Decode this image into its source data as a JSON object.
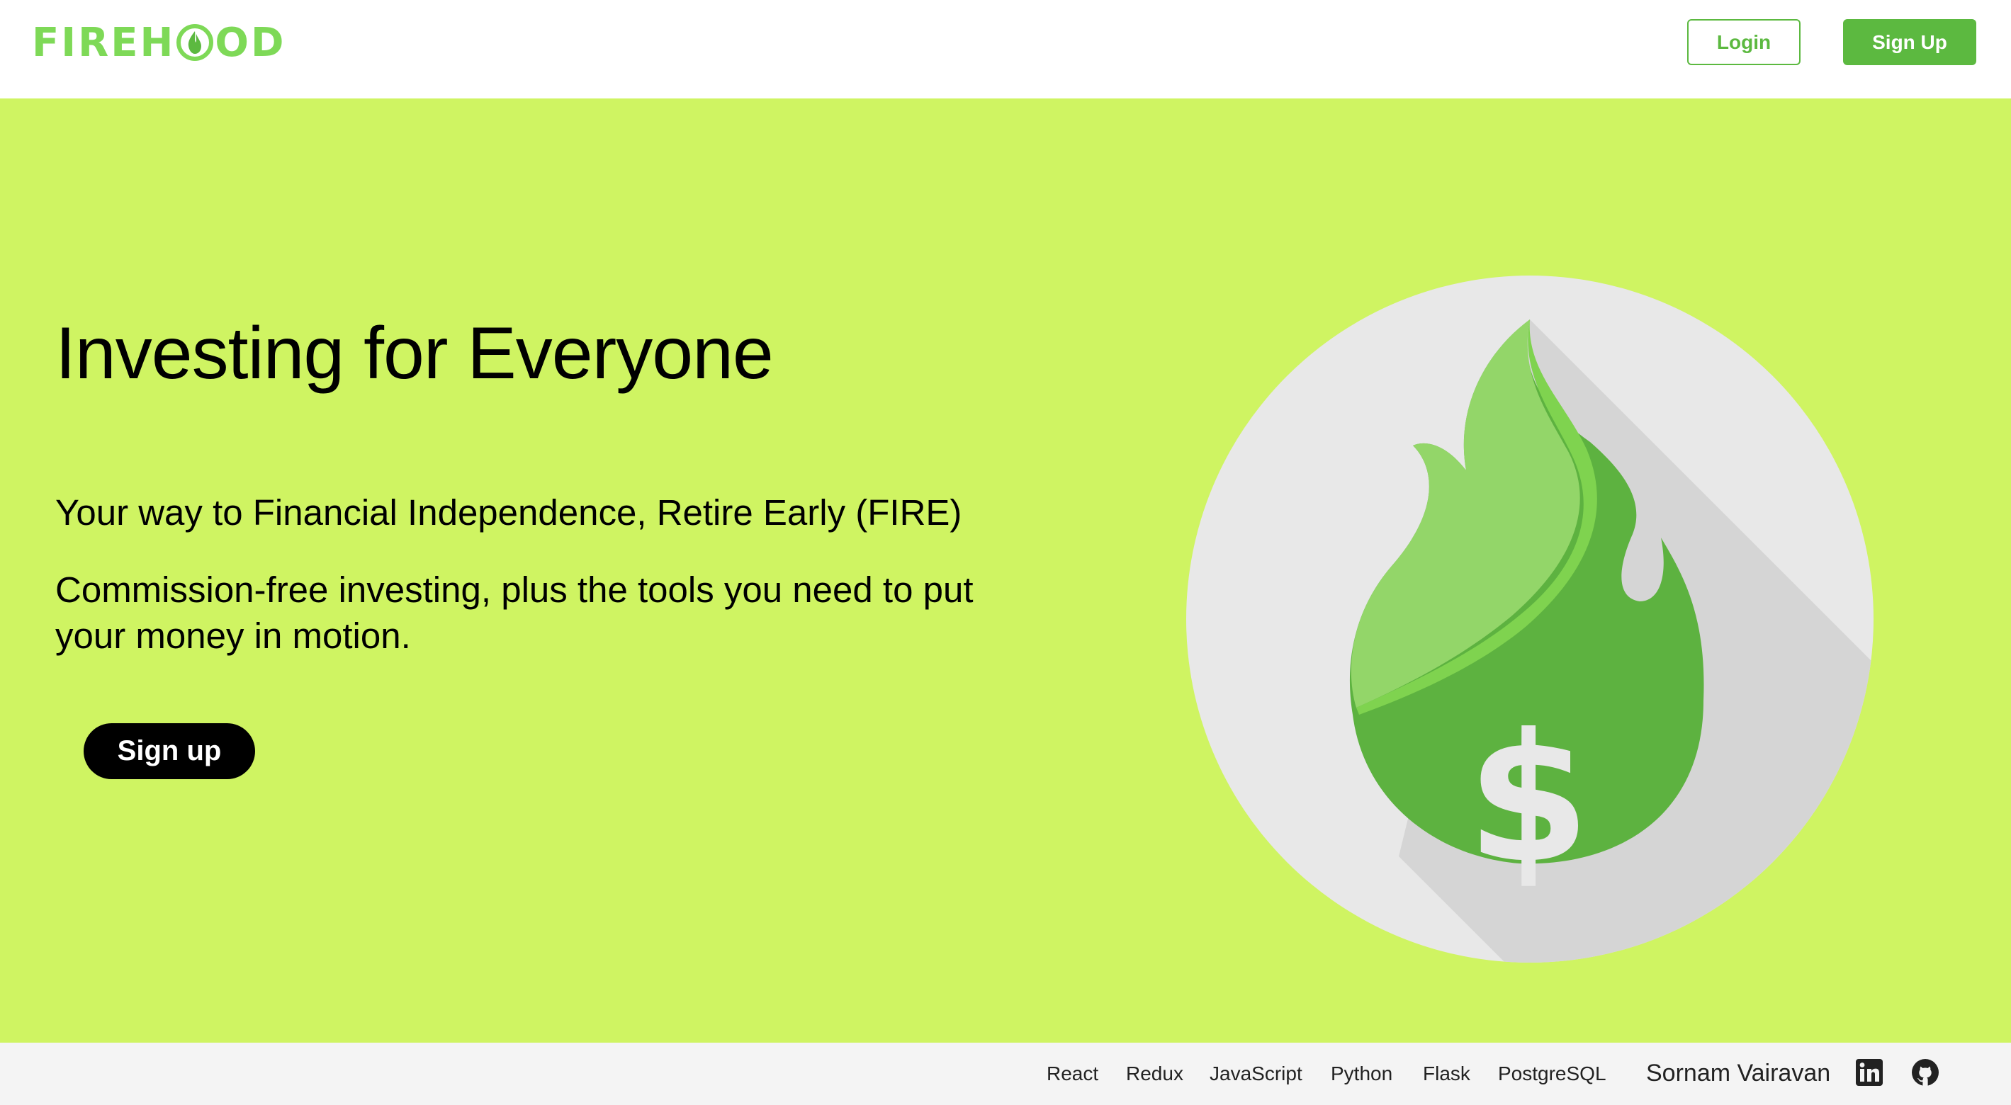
{
  "header": {
    "logo_prefix": "FIREH",
    "logo_suffix": "OD",
    "logo_icon": "flame-o-icon",
    "login_label": "Login",
    "signup_label": "Sign Up"
  },
  "hero": {
    "headline": "Investing for Everyone",
    "subtitle": "Your way to Financial Independence, Retire Early (FIRE)",
    "description": "Commission-free investing, plus the tools you need to put your money in motion.",
    "cta_label": "Sign up",
    "illustration_icon": "flame-dollar-icon"
  },
  "footer": {
    "tech_links": [
      "React",
      "Redux",
      "JavaScript",
      "Python",
      "Flask",
      "PostgreSQL"
    ],
    "author": "Sornam Vairavan",
    "social_icons": [
      "linkedin-icon",
      "github-icon"
    ]
  },
  "colors": {
    "brand_green": "#5cb940",
    "logo_green": "#7ed957",
    "hero_background": "#cff462",
    "footer_background": "#f4f4f4",
    "cta_background": "#000000"
  }
}
